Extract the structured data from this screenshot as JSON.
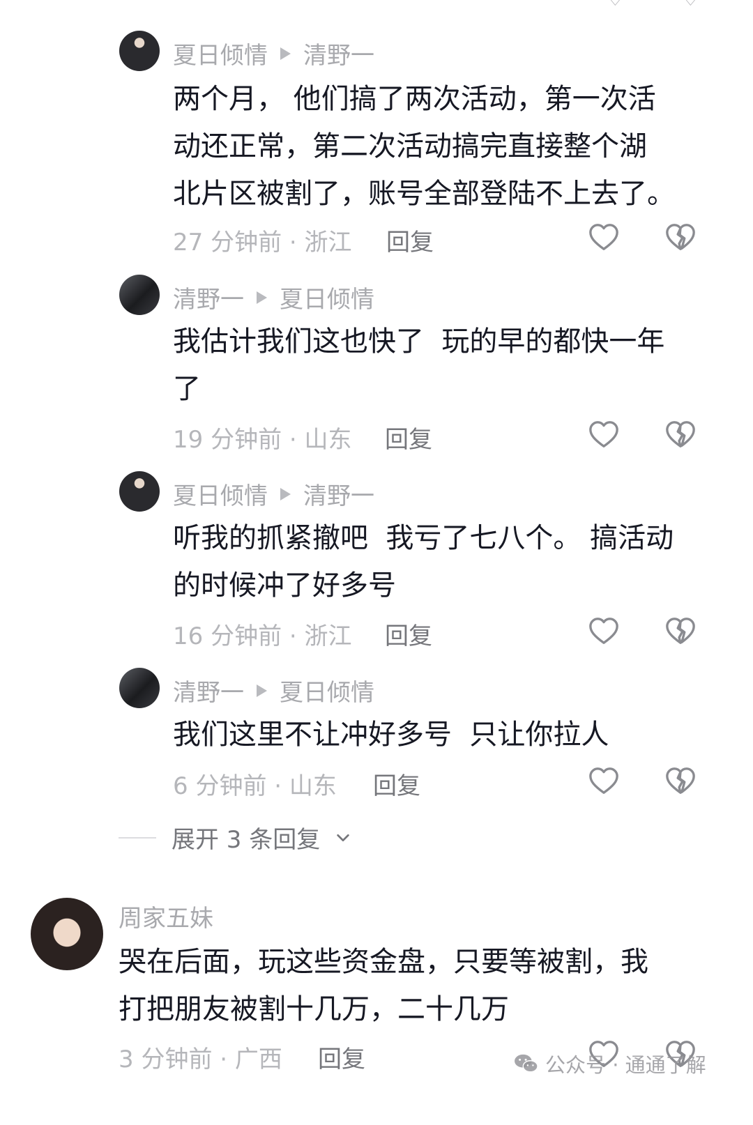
{
  "comments": [
    {
      "author": "夏日倾情",
      "reply_to": "清野一",
      "text": "两个月， 他们搞了两次活动，第一次活\n动还正常，第二次活动搞完直接整个湖\n北片区被割了，账号全部登陆不上去了。",
      "meta": "27 分钟前 · 浙江",
      "reply_label": "回复",
      "avatar": "man-suit-avatar"
    },
    {
      "author": "清野一",
      "reply_to": "夏日倾情",
      "text": "我估计我们这也快了  玩的早的都快一年\n了",
      "meta": "19 分钟前 · 山东",
      "reply_label": "回复",
      "avatar": "man-dark-avatar"
    },
    {
      "author": "夏日倾情",
      "reply_to": "清野一",
      "text": "听我的抓紧撤吧  我亏了七八个。 搞活动\n的时候冲了好多号",
      "meta": "16 分钟前 · 浙江",
      "reply_label": "回复",
      "avatar": "man-suit-avatar"
    },
    {
      "author": "清野一",
      "reply_to": "夏日倾情",
      "text": "我们这里不让冲好多号  只让你拉人",
      "meta": "6 分钟前 · 山东",
      "reply_label": "回复",
      "avatar": "man-dark-avatar"
    }
  ],
  "expand_label": "展开 3 条回复",
  "top_comment": {
    "author": "周家五妹",
    "text": "哭在后面，玩这些资金盘，只要等被割，我\n打把朋友被割十几万，二十几万",
    "meta": "3 分钟前 · 广西",
    "reply_label": "回复",
    "avatar": "woman-avatar"
  },
  "watermark": {
    "text": "公众号 · 通通了解",
    "icon": "wechat-icon"
  },
  "colors": {
    "text_primary": "#161823",
    "text_meta": "#b5b6ba",
    "text_name": "#a8a9ad",
    "reply": "#75767b",
    "icon_stroke": "#8a8b90"
  }
}
